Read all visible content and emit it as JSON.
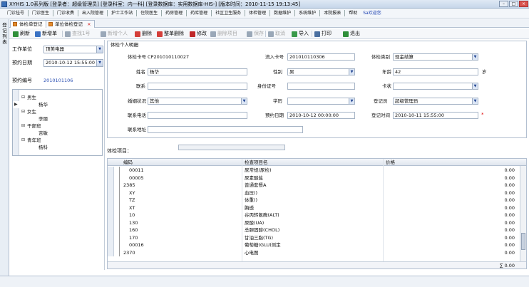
{
  "window": {
    "title": "XYHIS 1.0系列版  [登录者：超级管理员]  [登录科室：内一科]  [登录数据库：实用数据库-HIS-]  [版本时间：2010-11-15 19:13:45]"
  },
  "menu": [
    "门诊挂号",
    "门诊医生",
    "门诊收费",
    "出入院管理",
    "护士工作站",
    "住院医生",
    "药房管理",
    "药库管理",
    "社区卫生服务",
    "体检管理",
    "数据维护",
    "系统维护",
    "本院报表",
    "帮助"
  ],
  "menu_user": "Sa欢迎您",
  "tabs": [
    {
      "label": "体检单登记"
    },
    {
      "label": "单位体检登记",
      "close": "×"
    }
  ],
  "left_strip": "登记列表",
  "toolbar": [
    "刷新",
    "新增单",
    "查找1号",
    "新增个人",
    "删除",
    "整单删除",
    "修改",
    "删除项目",
    "保存",
    "取消",
    "导入",
    "打印",
    "退出"
  ],
  "left": {
    "unit_label": "工作单位",
    "unit_value": "顶美电器",
    "date_label": "预约日期",
    "date_value": "2010-10-12 15:55:00",
    "no_label": "预约编号",
    "no_value": "2010101106",
    "tree": [
      {
        "text": "男生",
        "indent": 0,
        "marker": "⊟"
      },
      {
        "text": "杨华",
        "indent": 1,
        "marker": ""
      },
      {
        "text": "女生",
        "indent": 0,
        "marker": "⊟"
      },
      {
        "text": "李丽",
        "indent": 1,
        "marker": ""
      },
      {
        "text": "干部班",
        "indent": 0,
        "marker": "⊟"
      },
      {
        "text": "吉敏",
        "indent": 1,
        "marker": ""
      },
      {
        "text": "青年班",
        "indent": 0,
        "marker": "⊟"
      },
      {
        "text": "杨科",
        "indent": 1,
        "marker": ""
      }
    ]
  },
  "form": {
    "group_title": "体检个人明细",
    "card_no_label": "体检卡号",
    "card_no_value": "CP201010110027",
    "flow_no_label": "流入卡号",
    "flow_no_value": "201010110306",
    "type_label": "体检类别",
    "type_value": "现金结算",
    "name_label": "姓名",
    "name_value": "杨华",
    "sex_label": "性别",
    "sex_value": "男",
    "age_label": "年龄",
    "age_value": "42",
    "age_unit": "岁",
    "mobile_label": "联系",
    "mobile_value": "",
    "idno_label": "身份证号",
    "idno_value": "",
    "ic_label": "卡状",
    "ic_value": "",
    "marital_label": "婚姻状况",
    "marital_value": "其他",
    "edu_label": "学历",
    "edu_value": "",
    "registrar_label": "登记员",
    "registrar_value": "超级管理员",
    "phone_label": "联系电话",
    "phone_value": "",
    "appt_label": "预约日期",
    "appt_value": "2010-10-12 00:00:00",
    "regtime_label": "登记时间",
    "regtime_value": "2010-10-11 15:55:00",
    "star": "*",
    "addr_label": "联系地址",
    "addr_value": ""
  },
  "items": {
    "label": "体检项目：",
    "headers": [
      "编码",
      "检查项目名",
      "价格"
    ],
    "rows": [
      {
        "code": "00011",
        "name": "尿常规(尿检)",
        "price": "0.00"
      },
      {
        "code": "00005",
        "name": "尿素酸盐",
        "price": "0.00"
      },
      {
        "code": "2385",
        "name": "普通套餐A",
        "price": "0.00"
      },
      {
        "code": "XY",
        "name": "血压()",
        "price": "0.00"
      },
      {
        "code": "TZ",
        "name": "体重()",
        "price": "0.00"
      },
      {
        "code": "XT",
        "name": "胸透",
        "price": "0.00"
      },
      {
        "code": "10",
        "name": "谷丙转氨酶(ALT)",
        "price": "0.00"
      },
      {
        "code": "130",
        "name": "尿酸(UA)",
        "price": "0.00"
      },
      {
        "code": "160",
        "name": "总胆固醇(CHOL)",
        "price": "0.00"
      },
      {
        "code": "170",
        "name": "甘油三脂(TG)",
        "price": "0.00"
      },
      {
        "code": "00016",
        "name": "葡萄糖(GLU)测定",
        "price": "0.00"
      },
      {
        "code": "2370",
        "name": "心电图",
        "price": "0.00"
      }
    ],
    "total": "∑ 0.00"
  }
}
